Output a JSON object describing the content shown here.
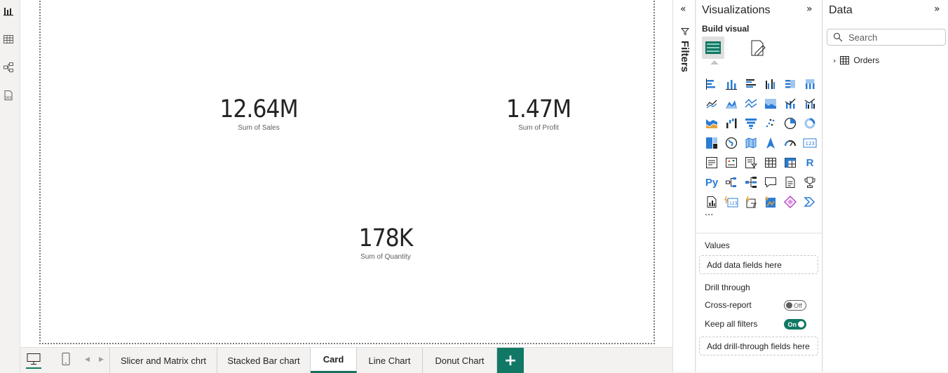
{
  "cards": [
    {
      "value": "12.64M",
      "label": "Sum of Sales"
    },
    {
      "value": "1.47M",
      "label": "Sum of Profit"
    },
    {
      "value": "178K",
      "label": "Sum of Quantity"
    }
  ],
  "tabs": [
    {
      "label": "Slicer and Matrix chrt",
      "active": false
    },
    {
      "label": "Stacked Bar chart",
      "active": false
    },
    {
      "label": "Card",
      "active": true
    },
    {
      "label": "Line Chart",
      "active": false
    },
    {
      "label": "Donut Chart",
      "active": false
    }
  ],
  "add_tab_label": "+",
  "filters": {
    "title": "Filters"
  },
  "visualizations": {
    "title": "Visualizations",
    "build_visual": "Build visual",
    "more": "···",
    "values_label": "Values",
    "values_placeholder": "Add data fields here",
    "drill_through": "Drill through",
    "cross_report": "Cross-report",
    "cross_report_state": "Off",
    "keep_all_filters": "Keep all filters",
    "keep_all_filters_state": "On",
    "drill_placeholder": "Add drill-through fields here"
  },
  "data": {
    "title": "Data",
    "search_placeholder": "Search",
    "tables": [
      "Orders"
    ]
  },
  "colors": {
    "accent": "#117865",
    "icon_blue": "#2b7cd3"
  }
}
